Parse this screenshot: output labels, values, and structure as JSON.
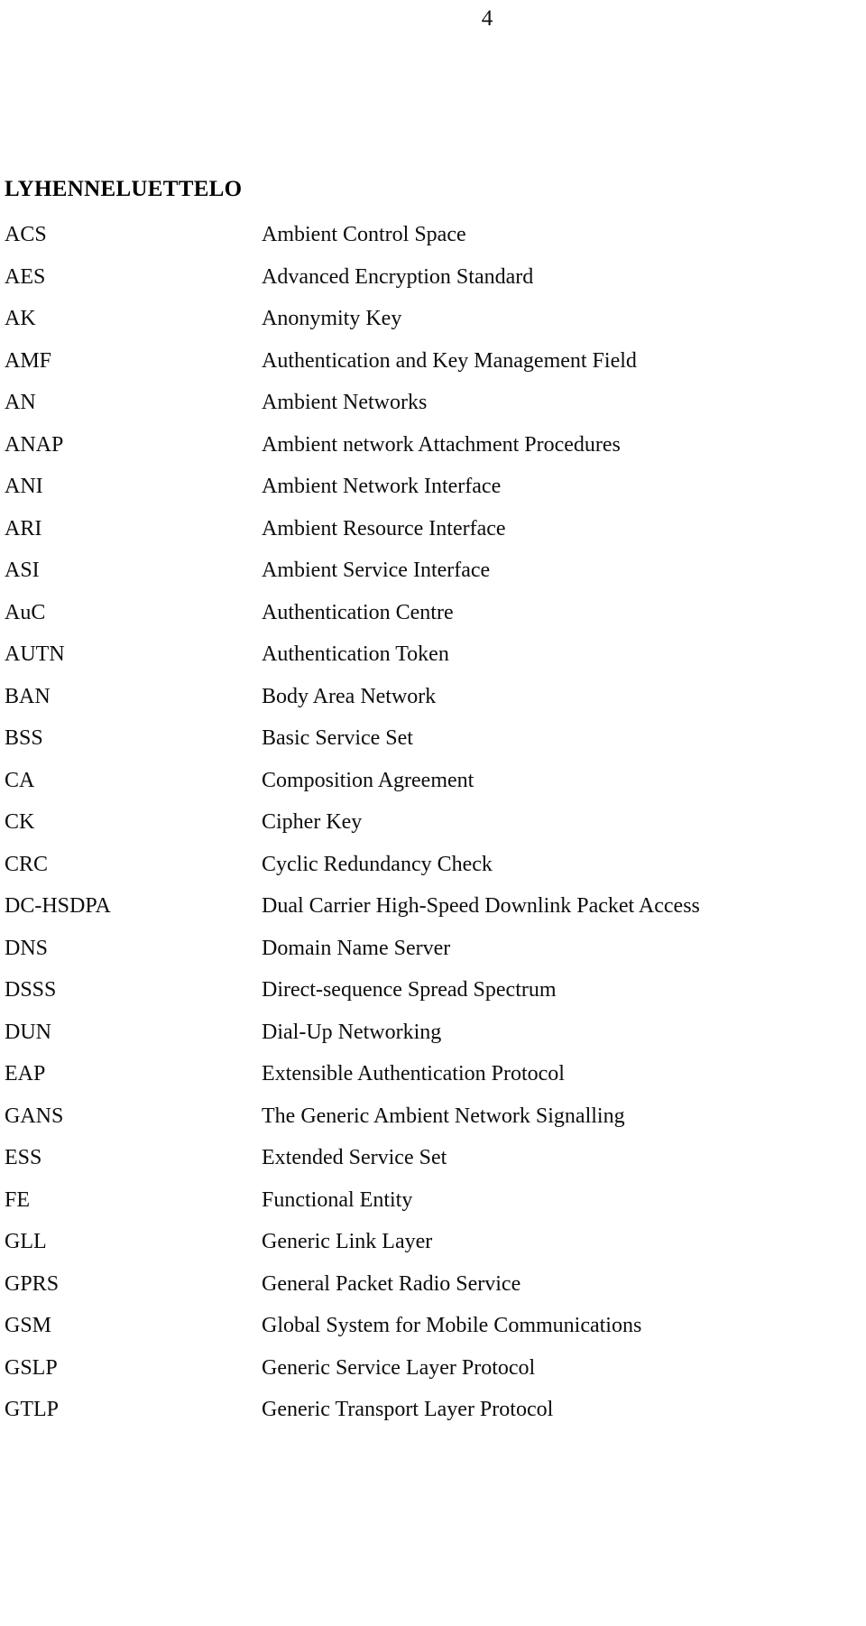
{
  "page": {
    "number": "4"
  },
  "section": {
    "title": "LYHENNELUETTELO"
  },
  "abbreviations": {
    "rows": [
      {
        "term": "ACS",
        "definition": "Ambient Control Space"
      },
      {
        "term": "AES",
        "definition": "Advanced Encryption Standard"
      },
      {
        "term": "AK",
        "definition": "Anonymity Key"
      },
      {
        "term": "AMF",
        "definition": "Authentication and Key Management Field"
      },
      {
        "term": "AN",
        "definition": "Ambient Networks"
      },
      {
        "term": "ANAP",
        "definition": "Ambient network Attachment Procedures"
      },
      {
        "term": "ANI",
        "definition": "Ambient Network Interface"
      },
      {
        "term": "ARI",
        "definition": "Ambient Resource Interface"
      },
      {
        "term": "ASI",
        "definition": "Ambient Service Interface"
      },
      {
        "term": "AuC",
        "definition": "Authentication Centre"
      },
      {
        "term": "AUTN",
        "definition": "Authentication Token"
      },
      {
        "term": "BAN",
        "definition": "Body Area Network"
      },
      {
        "term": "BSS",
        "definition": "Basic Service Set"
      },
      {
        "term": "CA",
        "definition": "Composition Agreement"
      },
      {
        "term": "CK",
        "definition": "Cipher Key"
      },
      {
        "term": "CRC",
        "definition": "Cyclic Redundancy Check"
      },
      {
        "term": "DC-HSDPA",
        "definition": "Dual Carrier High-Speed Downlink Packet Access"
      },
      {
        "term": "DNS",
        "definition": "Domain Name Server"
      },
      {
        "term": "DSSS",
        "definition": "Direct-sequence Spread Spectrum"
      },
      {
        "term": "DUN",
        "definition": "Dial-Up Networking"
      },
      {
        "term": "EAP",
        "definition": "Extensible Authentication Protocol"
      },
      {
        "term": "GANS",
        "definition": "The Generic Ambient Network Signalling"
      },
      {
        "term": "ESS",
        "definition": "Extended Service Set"
      },
      {
        "term": "FE",
        "definition": "Functional Entity"
      },
      {
        "term": "GLL",
        "definition": "Generic Link Layer"
      },
      {
        "term": "GPRS",
        "definition": "General Packet Radio Service"
      },
      {
        "term": "GSM",
        "definition": "Global System for Mobile Communications"
      },
      {
        "term": "GSLP",
        "definition": "Generic Service Layer Protocol"
      },
      {
        "term": "GTLP",
        "definition": "Generic Transport Layer Protocol"
      }
    ]
  }
}
